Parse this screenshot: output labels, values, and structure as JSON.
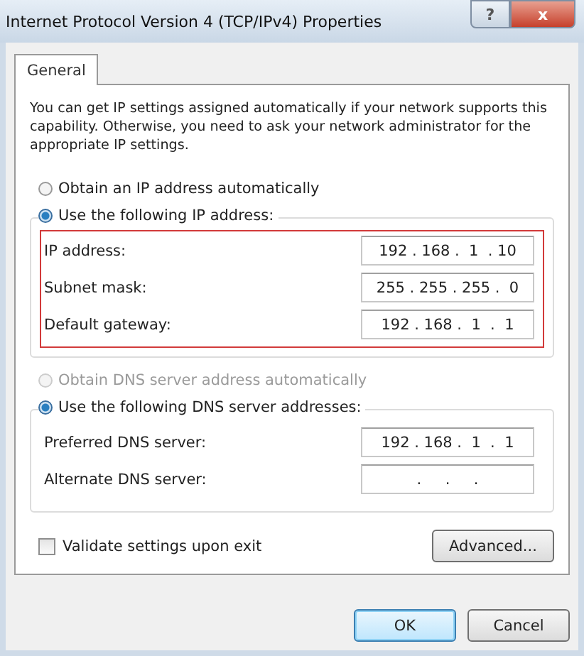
{
  "window": {
    "title": "Internet Protocol Version 4 (TCP/IPv4) Properties"
  },
  "title_buttons": [
    {
      "kind": "help",
      "label": "?"
    },
    {
      "kind": "close",
      "label": "x"
    }
  ],
  "tabs": [
    {
      "label": "General",
      "selected": true
    }
  ],
  "description": "You can get IP settings assigned automatically if your network supports this capability. Otherwise, you need to ask your network administrator for the appropriate IP settings.",
  "ip_section": {
    "options": [
      {
        "label": "Obtain an IP address automatically",
        "selected": false,
        "disabled": false
      },
      {
        "label": "Use the following IP address:",
        "selected": true,
        "disabled": false
      }
    ],
    "highlighted": true,
    "fields": [
      {
        "label": "IP address:",
        "value": "192 . 168 .  1  . 10"
      },
      {
        "label": "Subnet mask:",
        "value": "255 . 255 . 255 .  0"
      },
      {
        "label": "Default gateway:",
        "value": "192 . 168 .  1  .  1"
      }
    ]
  },
  "dns_section": {
    "options": [
      {
        "label": "Obtain DNS server address automatically",
        "selected": false,
        "disabled": true
      },
      {
        "label": "Use the following DNS server addresses:",
        "selected": true,
        "disabled": false
      }
    ],
    "highlighted": false,
    "fields": [
      {
        "label": "Preferred DNS server:",
        "value": "192 . 168 .  1  .  1"
      },
      {
        "label": "Alternate DNS server:",
        "value": "  .     .     .  "
      }
    ]
  },
  "validate": {
    "label": "Validate settings upon exit",
    "checked": false
  },
  "advanced_button": "Advanced...",
  "buttons": [
    {
      "label": "OK",
      "default": true
    },
    {
      "label": "Cancel",
      "default": false
    }
  ]
}
